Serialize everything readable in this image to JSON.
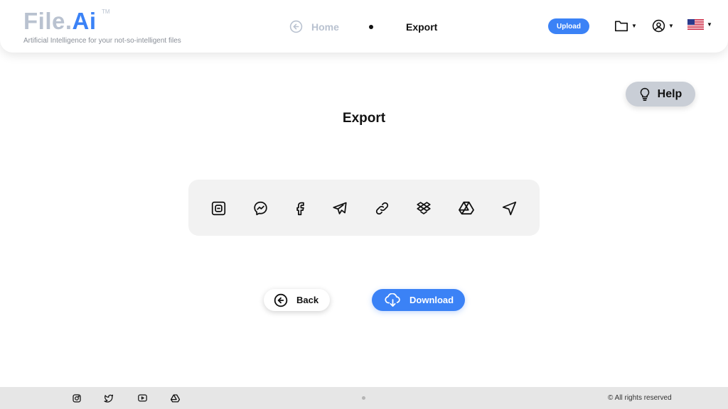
{
  "brand": {
    "logo_file": "File.",
    "logo_ai": "Ai",
    "trademark": "TM",
    "tagline": "Artificial Intelligence for your not-so-intelligent files"
  },
  "nav": {
    "home_label": "Home",
    "current_label": "Export"
  },
  "header": {
    "upload_label": "Upload",
    "icons": [
      "folder-icon",
      "account-icon",
      "us-flag-icon"
    ]
  },
  "help": {
    "label": "Help"
  },
  "page": {
    "title": "Export"
  },
  "share_targets": [
    "blogger-icon",
    "messenger-icon",
    "facebook-icon",
    "telegram-icon",
    "link-icon",
    "dropbox-icon",
    "google-drive-icon",
    "send-icon"
  ],
  "actions": {
    "back_label": "Back",
    "download_label": "Download"
  },
  "footer": {
    "social": [
      "instagram-icon",
      "twitter-icon",
      "youtube-icon",
      "google-drive-icon"
    ],
    "copyright": "© All rights reserved"
  },
  "colors": {
    "accent": "#3b82f6",
    "muted": "#b9c2d0",
    "help_bg": "#c9ced6",
    "panel_bg": "#f2f2f2",
    "footer_bg": "#e6e6e6"
  }
}
